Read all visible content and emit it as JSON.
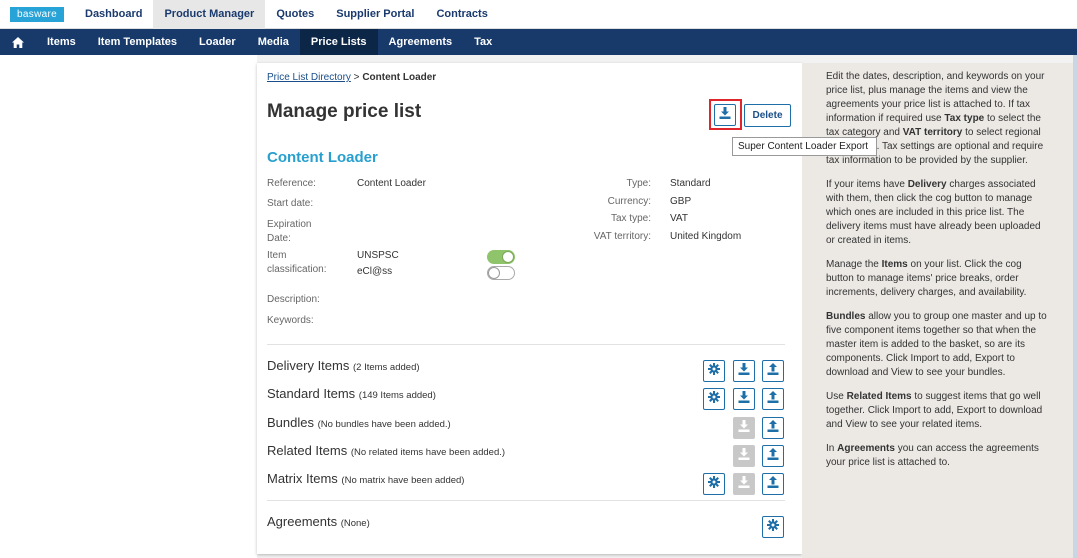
{
  "topnav": {
    "logo": "basware",
    "tabs": [
      "Dashboard",
      "Product Manager",
      "Quotes",
      "Supplier Portal",
      "Contracts"
    ],
    "active": "Product Manager"
  },
  "subnav": {
    "items": [
      "Items",
      "Item Templates",
      "Loader",
      "Media",
      "Price Lists",
      "Agreements",
      "Tax"
    ],
    "active": "Price Lists"
  },
  "breadcrumb": {
    "link": "Price List Directory",
    "sep": " > ",
    "current": "Content Loader"
  },
  "page": {
    "title": "Manage price list",
    "delete_label": "Delete",
    "export_tooltip": "Super Content Loader Export",
    "subtitle": "Content Loader"
  },
  "details": {
    "reference_label": "Reference:",
    "reference_value": "Content Loader",
    "start_label": "Start date:",
    "expiration_label_1": "Expiration",
    "expiration_label_2": "Date:",
    "item_label_1": "Item",
    "item_label_2": "classification:",
    "class_1": "UNSPSC",
    "class_1_on": true,
    "class_2": "eCl@ss",
    "class_2_on": false,
    "description_label": "Description:",
    "keywords_label": "Keywords:",
    "type_label": "Type:",
    "type_value": "Standard",
    "currency_label": "Currency:",
    "currency_value": "GBP",
    "taxtype_label": "Tax type:",
    "taxtype_value": "VAT",
    "vat_label": "VAT territory:",
    "vat_value": "United Kingdom"
  },
  "sections": {
    "delivery": {
      "name": "Delivery Items",
      "note": "(2 Items added)"
    },
    "standard": {
      "name": "Standard Items",
      "note": "(149 Items added)"
    },
    "bundles": {
      "name": "Bundles",
      "note": "(No bundles have been added.)"
    },
    "related": {
      "name": "Related Items",
      "note": "(No related items have been added.)"
    },
    "matrix": {
      "name": "Matrix Items",
      "note": "(No matrix have been added)"
    },
    "agreements": {
      "name": "Agreements",
      "note": "(None)"
    }
  },
  "help": {
    "p1_a": "Edit the dates, description, and keywords on your price list, plus manage the items and view the agreements your price list is attached to. If tax information if required use ",
    "p1_b": "Tax type",
    "p1_c": " to select the tax category and ",
    "p1_d": "VAT territory",
    "p1_e": " to select regional tax settings. Tax settings are optional and require tax information to be provided by the supplier.",
    "p2_a": "If your items have ",
    "p2_b": "Delivery",
    "p2_c": " charges associated with them, then click the cog button to manage which ones are included in this price list. The delivery items must have already been uploaded or created in items.",
    "p3_a": "Manage the ",
    "p3_b": "Items",
    "p3_c": " on your list. Click the cog button to manage items' price breaks, order increments, delivery charges, and availability.",
    "p4_b": "Bundles",
    "p4_c": " allow you to group one master and up to five component items together so that when the master item is added to the basket, so are its components. Click Import to add, Export to download and View to see your bundles.",
    "p5_a": "Use ",
    "p5_b": "Related Items",
    "p5_c": " to suggest items that go well together. Click Import to add, Export to download and View to see your related items.",
    "p6_a": "In ",
    "p6_b": "Agreements",
    "p6_c": " you can access the agreements your price list is attached to."
  }
}
